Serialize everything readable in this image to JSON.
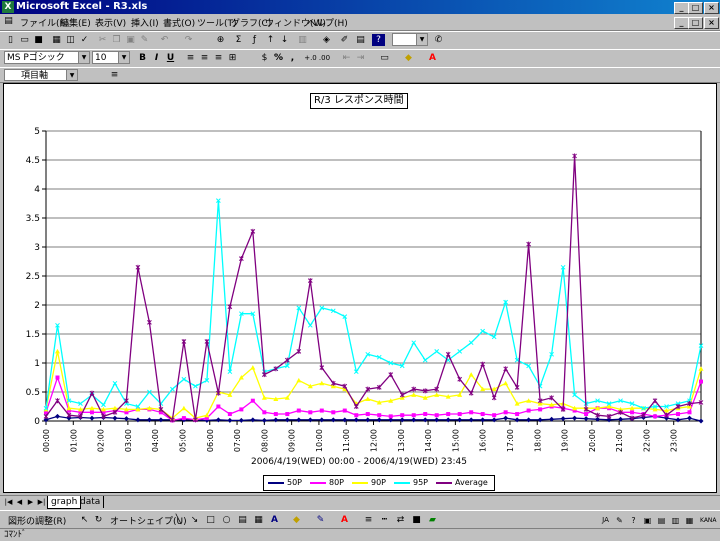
{
  "window": {
    "title": "Microsoft Excel - R3.xls",
    "app_icon": "X"
  },
  "menubar": {
    "items": [
      "ファイル(F)",
      "編集(E)",
      "表示(V)",
      "挿入(I)",
      "書式(O)",
      "ツール(T)",
      "グラフ(C)",
      "ウィンドウ(W)",
      "ヘルプ(H)"
    ]
  },
  "format_toolbar": {
    "font": "MS Pゴシック",
    "size": "10",
    "bold": "B",
    "italic": "I",
    "underline": "U",
    "percent": "%",
    "comma": ","
  },
  "chart_toolbar": {
    "element": "項目軸",
    "format_icon": "≡"
  },
  "sheet_tabs": {
    "tabs": [
      "graph",
      "data"
    ]
  },
  "drawing_toolbar": {
    "shape_adjust": "図形の調整(R)",
    "autoshape": "オートシェイプ(U)"
  },
  "statusbar": {
    "text": "ｺﾏﾝﾄﾞ"
  },
  "colors": {
    "s50p": "#000080",
    "s80p": "#ff00ff",
    "s90p": "#ffff00",
    "s95p": "#00ffff",
    "avg": "#800080"
  },
  "chart_data": {
    "type": "line",
    "title": "R/3 レスポンス時間",
    "xlabel": "2006/4/19(WED) 00:00 - 2006/4/19(WED) 23:45",
    "ylim": [
      0,
      5
    ],
    "yticks": [
      "0",
      "0.5",
      "1",
      "1.5",
      "2",
      "2.5",
      "3",
      "3.5",
      "4",
      "4.5",
      "5"
    ],
    "xtick_labels": [
      "00:00",
      "01:00",
      "02:00",
      "03:00",
      "04:00",
      "05:00",
      "06:00",
      "07:00",
      "08:00",
      "09:00",
      "10:00",
      "11:00",
      "12:00",
      "13:00",
      "14:00",
      "15:00",
      "16:00",
      "17:00",
      "18:00",
      "19:00",
      "20:00",
      "21:00",
      "22:00",
      "23:00"
    ],
    "grid": true,
    "legend": "bottom",
    "series": [
      {
        "name": "50P",
        "values": [
          0.02,
          0.08,
          0.05,
          0.06,
          0.05,
          0.06,
          0.05,
          0.04,
          0.02,
          0.02,
          0.02,
          0.02,
          0.02,
          0.02,
          0.01,
          0.02,
          0.01,
          0.01,
          0.02,
          0.01,
          0.02,
          0.02,
          0.02,
          0.02,
          0.02,
          0.02,
          0.02,
          0.02,
          0.02,
          0.02,
          0.02,
          0.02,
          0.02,
          0.02,
          0.02,
          0.02,
          0.02,
          0.02,
          0.02,
          0.02,
          0.05,
          0.02,
          0.02,
          0.02,
          0.03,
          0.04,
          0.05,
          0.04,
          0.03,
          0.02,
          0.03,
          0.04,
          0.06,
          0.08,
          0.05,
          0.02,
          0.05,
          0.0
        ]
      },
      {
        "name": "80P",
        "values": [
          0.15,
          0.75,
          0.18,
          0.15,
          0.15,
          0.15,
          0.18,
          0.15,
          0.2,
          0.2,
          0.15,
          0.01,
          0.05,
          0.02,
          0.05,
          0.25,
          0.12,
          0.2,
          0.35,
          0.15,
          0.12,
          0.12,
          0.18,
          0.15,
          0.18,
          0.15,
          0.18,
          0.1,
          0.12,
          0.1,
          0.08,
          0.1,
          0.1,
          0.12,
          0.1,
          0.12,
          0.12,
          0.15,
          0.12,
          0.1,
          0.15,
          0.12,
          0.18,
          0.2,
          0.25,
          0.22,
          0.18,
          0.12,
          0.22,
          0.22,
          0.15,
          0.15,
          0.12,
          0.08,
          0.1,
          0.12,
          0.15,
          0.68
        ]
      },
      {
        "name": "90P",
        "values": [
          0.2,
          1.2,
          0.22,
          0.2,
          0.22,
          0.2,
          0.22,
          0.2,
          0.2,
          0.22,
          0.2,
          0.05,
          0.22,
          0.05,
          0.1,
          0.5,
          0.45,
          0.75,
          0.92,
          0.4,
          0.38,
          0.4,
          0.7,
          0.6,
          0.65,
          0.6,
          0.55,
          0.3,
          0.38,
          0.32,
          0.35,
          0.4,
          0.45,
          0.4,
          0.45,
          0.42,
          0.45,
          0.8,
          0.55,
          0.55,
          0.65,
          0.3,
          0.35,
          0.3,
          0.28,
          0.3,
          0.22,
          0.22,
          0.22,
          0.25,
          0.2,
          0.22,
          0.22,
          0.2,
          0.18,
          0.22,
          0.25,
          0.9
        ]
      },
      {
        "name": "95P",
        "values": [
          0.22,
          1.65,
          0.35,
          0.3,
          0.45,
          0.28,
          0.65,
          0.3,
          0.25,
          0.5,
          0.3,
          0.55,
          0.72,
          0.6,
          0.7,
          3.8,
          0.85,
          1.85,
          1.85,
          0.85,
          0.9,
          0.95,
          1.95,
          1.65,
          1.95,
          1.9,
          1.8,
          0.85,
          1.15,
          1.1,
          1.0,
          0.95,
          1.35,
          1.05,
          1.2,
          1.05,
          1.2,
          1.35,
          1.55,
          1.45,
          2.05,
          1.05,
          0.95,
          0.6,
          1.15,
          2.65,
          0.45,
          0.3,
          0.35,
          0.3,
          0.35,
          0.3,
          0.22,
          0.25,
          0.25,
          0.3,
          0.35,
          1.3
        ]
      },
      {
        "name": "Average",
        "values": [
          0.08,
          0.35,
          0.1,
          0.08,
          0.48,
          0.08,
          0.15,
          0.35,
          2.65,
          1.7,
          0.2,
          0.02,
          1.37,
          0.02,
          1.37,
          0.48,
          1.97,
          2.8,
          3.27,
          0.8,
          0.9,
          1.05,
          1.2,
          2.42,
          0.92,
          0.65,
          0.6,
          0.25,
          0.55,
          0.58,
          0.8,
          0.45,
          0.55,
          0.52,
          0.55,
          1.15,
          0.72,
          0.48,
          0.98,
          0.4,
          0.9,
          0.58,
          3.05,
          0.35,
          0.4,
          0.2,
          4.57,
          0.2,
          0.1,
          0.08,
          0.15,
          0.05,
          0.1,
          0.35,
          0.1,
          0.25,
          0.3,
          0.32
        ]
      }
    ]
  }
}
